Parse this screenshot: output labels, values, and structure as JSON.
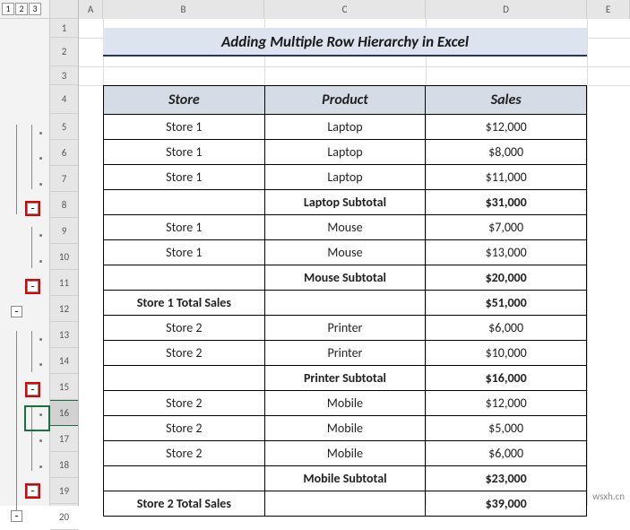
{
  "outline": {
    "level1": "1",
    "level2": "2",
    "level3": "3"
  },
  "cols": {
    "A": "A",
    "B": "B",
    "C": "C",
    "D": "D",
    "E": "E"
  },
  "rows": [
    "1",
    "2",
    "3",
    "4",
    "5",
    "6",
    "7",
    "8",
    "9",
    "10",
    "11",
    "12",
    "13",
    "14",
    "15",
    "16",
    "17",
    "18",
    "19",
    "20"
  ],
  "title": "Adding Multiple Row Hierarchy in Excel",
  "headers": {
    "store": "Store",
    "product": "Product",
    "sales": "Sales"
  },
  "data": [
    {
      "store": "Store 1",
      "product": "Laptop",
      "sales": "$12,000"
    },
    {
      "store": "Store 1",
      "product": "Laptop",
      "sales": "$8,000"
    },
    {
      "store": "Store 1",
      "product": "Laptop",
      "sales": "$11,000"
    },
    {
      "store": "",
      "product": "Laptop Subtotal",
      "sales": "$31,000",
      "sub": true
    },
    {
      "store": "Store 1",
      "product": "Mouse",
      "sales": "$7,000"
    },
    {
      "store": "Store 1",
      "product": "Mouse",
      "sales": "$13,000"
    },
    {
      "store": "",
      "product": "Mouse Subtotal",
      "sales": "$20,000",
      "sub": true
    },
    {
      "store": "Store 1 Total Sales",
      "product": "",
      "sales": "$51,000",
      "tot": true
    },
    {
      "store": "Store 2",
      "product": "Printer",
      "sales": "$6,000"
    },
    {
      "store": "Store 2",
      "product": "Printer",
      "sales": "$10,000"
    },
    {
      "store": "",
      "product": "Printer Subtotal",
      "sales": "$16,000",
      "sub": true
    },
    {
      "store": "Store 2",
      "product": "Mobile",
      "sales": "$12,000"
    },
    {
      "store": "Store 2",
      "product": "Mobile",
      "sales": "$5,000"
    },
    {
      "store": "Store 2",
      "product": "Mobile",
      "sales": "$6,000"
    },
    {
      "store": "",
      "product": "Mobile Subtotal",
      "sales": "$23,000",
      "sub": true
    },
    {
      "store": "Store 2 Total Sales",
      "product": "",
      "sales": "$39,000",
      "tot": true
    }
  ],
  "watermark": "wsxh.cn"
}
